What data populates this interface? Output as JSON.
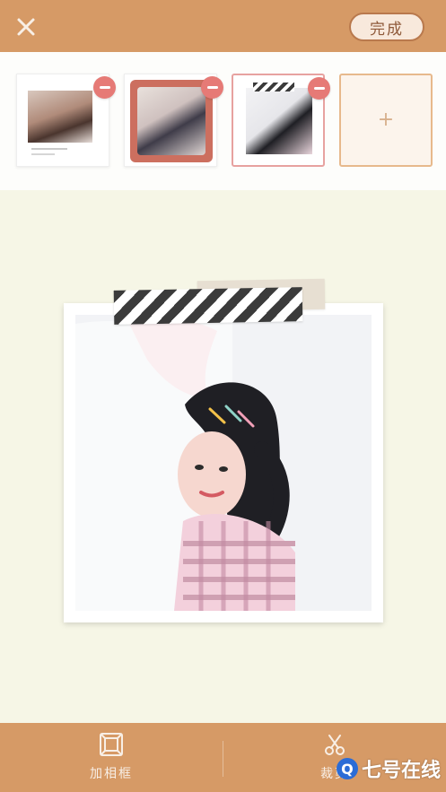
{
  "header": {
    "close_icon": "close-icon",
    "done_label": "完成"
  },
  "thumbnails": [
    {
      "name": "thumbnail-1",
      "selected": false
    },
    {
      "name": "thumbnail-2",
      "selected": false
    },
    {
      "name": "thumbnail-3",
      "selected": true
    }
  ],
  "add_thumbnail": {
    "icon": "plus-icon"
  },
  "toolbar": {
    "frame_label": "加相框",
    "cut_label": "裁剪"
  },
  "watermark": {
    "text": "七号在线"
  },
  "colors": {
    "accent": "#d69a66",
    "background": "#f6f6e6",
    "remove_badge": "#e67a76"
  }
}
